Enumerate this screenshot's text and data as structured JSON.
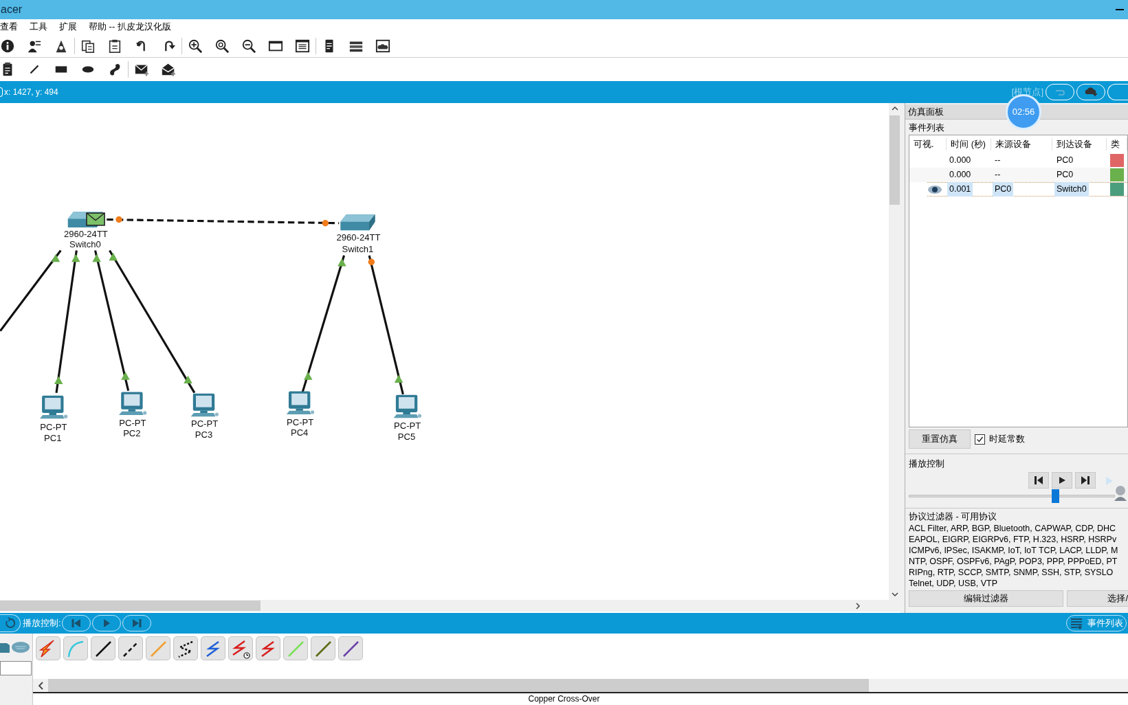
{
  "window": {
    "title": "acer"
  },
  "menu": [
    {
      "label": "查看"
    },
    {
      "label": "工具"
    },
    {
      "label": "扩展"
    },
    {
      "label": "帮助 -- 扒皮龙汉化版"
    }
  ],
  "status": {
    "coordinates": "x: 1427, y: 494",
    "breadcrumb": "[根节点]"
  },
  "timer": "02:56",
  "canvas": {
    "devices": [
      {
        "kind": "switch",
        "model": "2960-24TT",
        "name": "Switch0"
      },
      {
        "kind": "switch",
        "model": "2960-24TT",
        "name": "Switch1"
      },
      {
        "kind": "pc",
        "model": "PC-PT",
        "name": "PC1"
      },
      {
        "kind": "pc",
        "model": "PC-PT",
        "name": "PC2"
      },
      {
        "kind": "pc",
        "model": "PC-PT",
        "name": "PC3"
      },
      {
        "kind": "pc",
        "model": "PC-PT",
        "name": "PC4"
      },
      {
        "kind": "pc",
        "model": "PC-PT",
        "name": "PC5"
      }
    ],
    "packet": true
  },
  "sim_panel": {
    "title": "仿真面板",
    "event_list_label": "事件列表",
    "columns": [
      "可视.",
      "时间 (秒)",
      "来源设备",
      "到达设备",
      "类"
    ],
    "events": [
      {
        "visible": false,
        "time": "0.000",
        "from": "--",
        "to": "PC0",
        "color": "#e06666",
        "selected": false
      },
      {
        "visible": false,
        "time": "0.000",
        "from": "--",
        "to": "PC0",
        "color": "#6ab04c",
        "selected": false
      },
      {
        "visible": true,
        "time": "0.001",
        "from": "PC0",
        "to": "Switch0",
        "color": "#4a9e7e",
        "selected": true
      }
    ],
    "reset_button": "重置仿真",
    "constant_delay": {
      "label": "时延常数",
      "checked": true
    },
    "playback_label": "播放控制",
    "playback_slider": {
      "level": 0.71
    },
    "filter_title": "协议过滤器 - 可用协议",
    "protocols": [
      "ACL Filter, ARP, BGP, Bluetooth, CAPWAP, CDP, DHC",
      "EAPOL, EIGRP, EIGRPv6, FTP, H.323, HSRP, HSRPv",
      "ICMPv6, IPSec, ISAKMP, IoT, IoT TCP, LACP, LLDP, M",
      "NTP, OSPF, OSPFv6, PAgP, POP3, PPP, PPPoED, PT",
      "RIPng, RTP, SCCP, SMTP, SNMP, SSH, STP, SYSLO",
      "Telnet, UDP, USB, VTP"
    ],
    "buttons": [
      "编辑过滤器",
      "选择/"
    ]
  },
  "bottom_bar": {
    "playback_label": "播放控制:",
    "event_list_button": "事件列表"
  },
  "cable_tools": [
    {
      "kind": "auto"
    },
    {
      "kind": "console"
    },
    {
      "kind": "straight"
    },
    {
      "kind": "crossover"
    },
    {
      "kind": "fiber"
    },
    {
      "kind": "phone"
    },
    {
      "kind": "coax"
    },
    {
      "kind": "serial-dce"
    },
    {
      "kind": "serial-dte"
    },
    {
      "kind": "octal"
    },
    {
      "kind": "iot"
    },
    {
      "kind": "usb"
    }
  ],
  "selected_tool_label": "Copper Cross-Over"
}
